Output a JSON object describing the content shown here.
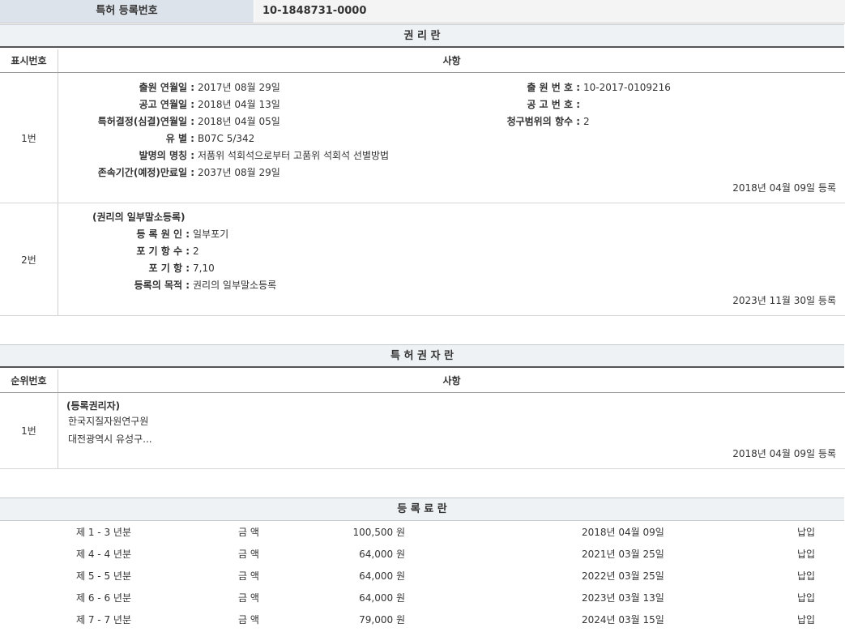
{
  "registration": {
    "label": "특허 등록번호",
    "value": "10-1848731-0000"
  },
  "rights": {
    "title": "권 리 란",
    "col_num": "표시번호",
    "col_desc": "사항",
    "entries": [
      {
        "num": "1번",
        "left": [
          {
            "label": "출원 연월일 :",
            "value": "2017년 08월 29일"
          },
          {
            "label": "공고 연월일 :",
            "value": "2018년 04월 13일"
          },
          {
            "label": "특허결정(심결)연월일 :",
            "value": "2018년 04월 05일"
          },
          {
            "label": "유 별 :",
            "value": "B07C 5/342"
          },
          {
            "label": "발명의 명칭 :",
            "value": "저품위 석회석으로부터 고품위 석회석 선별방법"
          },
          {
            "label": "존속기간(예정)만료일 :",
            "value": "2037년 08월 29일"
          }
        ],
        "right": [
          {
            "label": "출 원 번 호 :",
            "value": "10-2017-0109216"
          },
          {
            "label": "공 고 번 호 :",
            "value": ""
          },
          {
            "label": "청구범위의 항수 :",
            "value": "2"
          }
        ],
        "date": "2018년 04월 09일 등록"
      },
      {
        "num": "2번",
        "heading": "(권리의 일부말소등록)",
        "left": [
          {
            "label": "등 록 원 인 :",
            "value": "일부포기"
          },
          {
            "label": "포 기 항 수 :",
            "value": "2"
          },
          {
            "label": "포 기 항 :",
            "value": "7,10"
          },
          {
            "label": "등록의 목적 :",
            "value": "권리의 일부말소등록"
          }
        ],
        "date": "2023년 11월 30일 등록"
      }
    ]
  },
  "holders": {
    "title": "특 허 권 자 란",
    "col_num": "순위번호",
    "col_desc": "사항",
    "entry": {
      "num": "1번",
      "heading": "(등록권리자)",
      "name": "한국지질자원연구원",
      "address": "대전광역시 유성구...",
      "date": "2018년 04월 09일 등록"
    }
  },
  "fees": {
    "title": "등 록 료 란",
    "rows": [
      {
        "period": "제 1 - 3 년분",
        "label": "금 액",
        "amount": "100,500 원",
        "date": "2018년 04월 09일",
        "status": "납입"
      },
      {
        "period": "제 4 - 4 년분",
        "label": "금 액",
        "amount": "64,000 원",
        "date": "2021년 03월 25일",
        "status": "납입"
      },
      {
        "period": "제 5 - 5 년분",
        "label": "금 액",
        "amount": "64,000 원",
        "date": "2022년 03월 25일",
        "status": "납입"
      },
      {
        "period": "제 6 - 6 년분",
        "label": "금 액",
        "amount": "64,000 원",
        "date": "2023년 03월 13일",
        "status": "납입"
      },
      {
        "period": "제 7 - 7 년분",
        "label": "금 액",
        "amount": "79,000 원",
        "date": "2024년 03월 15일",
        "status": "납입"
      }
    ]
  }
}
